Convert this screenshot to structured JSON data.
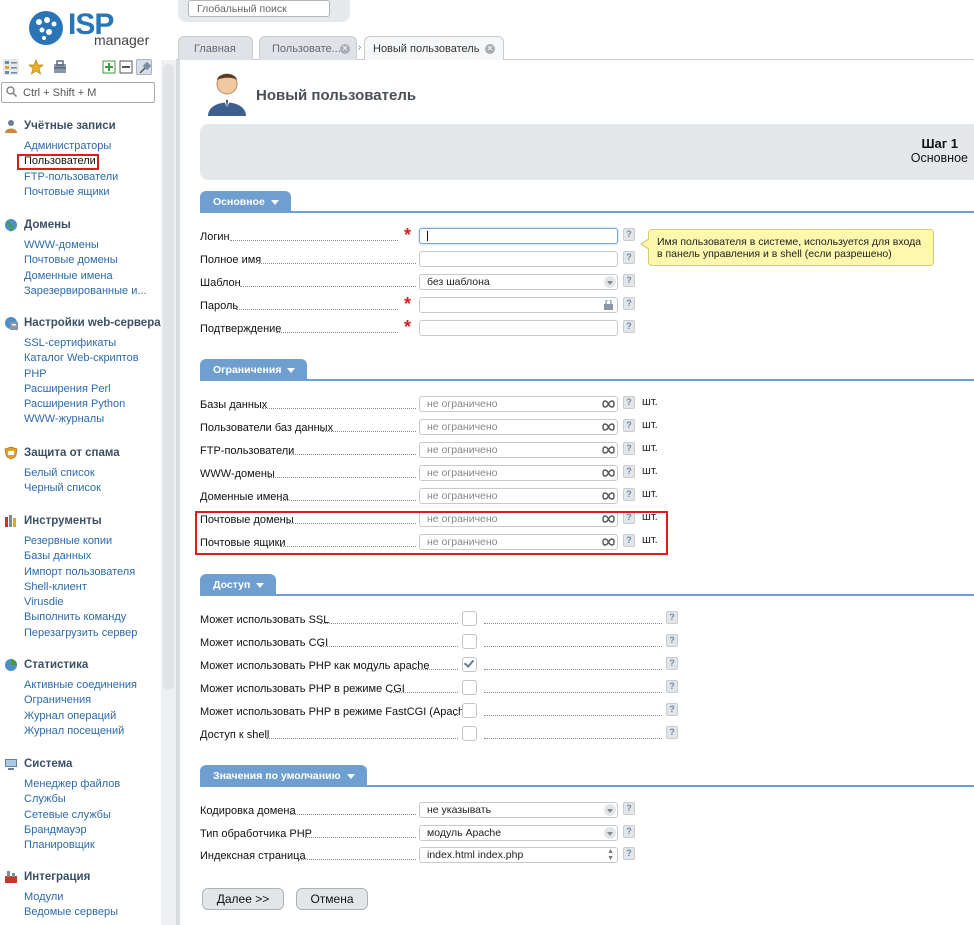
{
  "logo": {
    "big": "ISP",
    "small": "manager"
  },
  "sidebar": {
    "search_placeholder": "Ctrl + Shift + M",
    "groups": [
      {
        "title": "Учётные записи",
        "items": [
          "Администраторы",
          "Пользователи",
          "FTP-пользователи",
          "Почтовые ящики"
        ]
      },
      {
        "title": "Домены",
        "items": [
          "WWW-домены",
          "Почтовые домены",
          "Доменные имена",
          "Зарезервированные и..."
        ]
      },
      {
        "title": "Настройки web-сервера",
        "items": [
          "SSL-сертификаты",
          "Каталог Web-скриптов",
          "PHP",
          "Расширения Perl",
          "Расширения Python",
          "WWW-журналы"
        ]
      },
      {
        "title": "Защита от спама",
        "items": [
          "Белый список",
          "Черный список"
        ]
      },
      {
        "title": "Инструменты",
        "items": [
          "Резервные копии",
          "Базы данных",
          "Импорт пользователя",
          "Shell-клиент",
          "Virusdie",
          "Выполнить команду",
          "Перезагрузить сервер"
        ]
      },
      {
        "title": "Статистика",
        "items": [
          "Активные соединения",
          "Ограничения",
          "Журнал операций",
          "Журнал посещений"
        ]
      },
      {
        "title": "Система",
        "items": [
          "Менеджер файлов",
          "Службы",
          "Сетевые службы",
          "Брандмауэр",
          "Планировщик"
        ]
      },
      {
        "title": "Интеграция",
        "items": [
          "Модули",
          "Ведомые серверы"
        ]
      }
    ]
  },
  "topbar": {
    "search_placeholder": "Глобальный поиск",
    "tabs": [
      "Главная",
      "Пользовате...",
      "Новый пользователь"
    ]
  },
  "page": {
    "title": "Новый пользователь",
    "step_title": "Шаг 1",
    "step_sub": "Основное"
  },
  "sections": {
    "basic": {
      "title": "Основное",
      "login": "Логин",
      "fullname": "Полное имя",
      "template": "Шаблон",
      "template_value": "без шаблона",
      "password": "Пароль",
      "confirm": "Подтверждение",
      "tooltip": "Имя пользователя в системе, используется для входа в панель управления и в shell (если разрешено)"
    },
    "limits": {
      "title": "Ограничения",
      "placeholder": "не ограничено",
      "unit": "шт.",
      "rows": [
        "Базы данных",
        "Пользователи баз данных",
        "FTP-пользователи",
        "WWW-домены",
        "Доменные имена",
        "Почтовые домены",
        "Почтовые ящики"
      ]
    },
    "access": {
      "title": "Доступ",
      "rows": [
        "Может использовать SSL",
        "Может использовать CGI",
        "Может использовать PHP как модуль apache",
        "Может использовать PHP в режиме CGI",
        "Может использовать PHP в режиме FastCGI (Apache)",
        "Доступ к shell"
      ],
      "checked": [
        false,
        false,
        true,
        false,
        false,
        false
      ]
    },
    "defaults": {
      "title": "Значения по умолчанию",
      "encoding": "Кодировка домена",
      "encoding_value": "не указывать",
      "php_handler": "Тип обработчика PHP",
      "php_handler_value": "модуль Apache",
      "index": "Индексная страница",
      "index_value": "index.html index.php"
    }
  },
  "help_mark": "?",
  "buttons": {
    "next": "Далее >>",
    "cancel": "Отмена"
  },
  "colors": {
    "accent": "#6f9fd0",
    "highlight": "#e01b1b",
    "link": "#2d6aa8",
    "tooltip_bg": "#fdf8ad"
  }
}
